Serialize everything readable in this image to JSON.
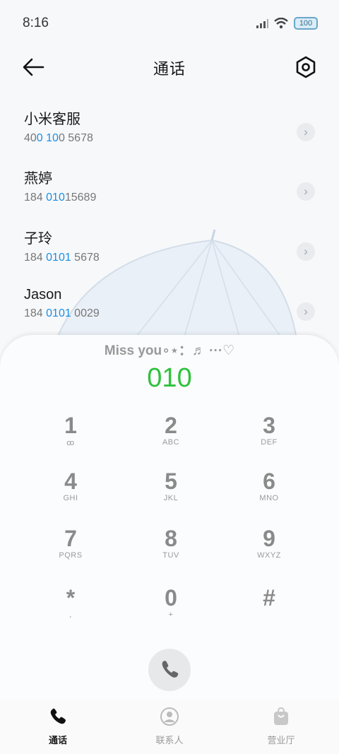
{
  "status_bar": {
    "time": "8:16",
    "battery": "100"
  },
  "header": {
    "title": "通话"
  },
  "contacts": [
    {
      "name": "小米客服",
      "num_pre": "40",
      "num_hl": "0 10",
      "num_post": "0 5678"
    },
    {
      "name": "燕婷",
      "num_pre": "184 ",
      "num_hl": "010",
      "num_post": "15689"
    },
    {
      "name": "子玲",
      "num_pre": "184 ",
      "num_hl": "0101",
      "num_post": " 5678"
    },
    {
      "name": "Jason",
      "num_pre": "184 ",
      "num_hl": "0101",
      "num_post": " 0029"
    }
  ],
  "dialer": {
    "banner": "Miss you∘⋆：♬ ···♡",
    "typed_number": "010",
    "keys": [
      {
        "digit": "1",
        "letters": "ꝏ"
      },
      {
        "digit": "2",
        "letters": "ABC"
      },
      {
        "digit": "3",
        "letters": "DEF"
      },
      {
        "digit": "4",
        "letters": "GHI"
      },
      {
        "digit": "5",
        "letters": "JKL"
      },
      {
        "digit": "6",
        "letters": "MNO"
      },
      {
        "digit": "7",
        "letters": "PQRS"
      },
      {
        "digit": "8",
        "letters": "TUV"
      },
      {
        "digit": "9",
        "letters": "WXYZ"
      },
      {
        "digit": "*",
        "letters": ","
      },
      {
        "digit": "0",
        "letters": "+"
      },
      {
        "digit": "#",
        "letters": ""
      }
    ]
  },
  "bottom_nav": [
    {
      "label": "通话",
      "icon": "phone-icon",
      "active": true
    },
    {
      "label": "联系人",
      "icon": "contact-icon",
      "active": false
    },
    {
      "label": "营业厅",
      "icon": "bag-icon",
      "active": false
    }
  ],
  "colors": {
    "accent_blue": "#1a8fe3",
    "typed_green": "#2fc13d"
  }
}
